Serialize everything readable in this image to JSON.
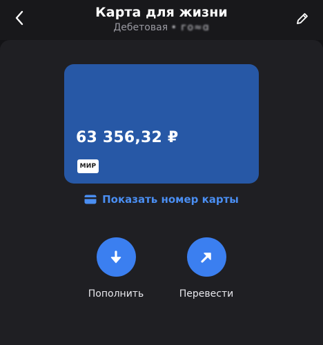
{
  "header": {
    "title": "Карта для жизни",
    "subtitle_type": "Дебетовая",
    "subtitle_masked": "• ⁠⁠⁠⁠"
  },
  "card": {
    "balance": "63 356,32 ₽",
    "payment_system": "МИР",
    "color": "#2758a6"
  },
  "show_number": {
    "label": "Показать номер карты",
    "icon": "card-icon"
  },
  "actions": [
    {
      "label": "Пополнить",
      "icon": "arrow-down-icon"
    },
    {
      "label": "Перевести",
      "icon": "arrow-up-right-icon"
    }
  ],
  "colors": {
    "accent": "#3b7ff0",
    "link": "#4a8ef2",
    "background": "#131316",
    "panel": "#1f1f23"
  }
}
